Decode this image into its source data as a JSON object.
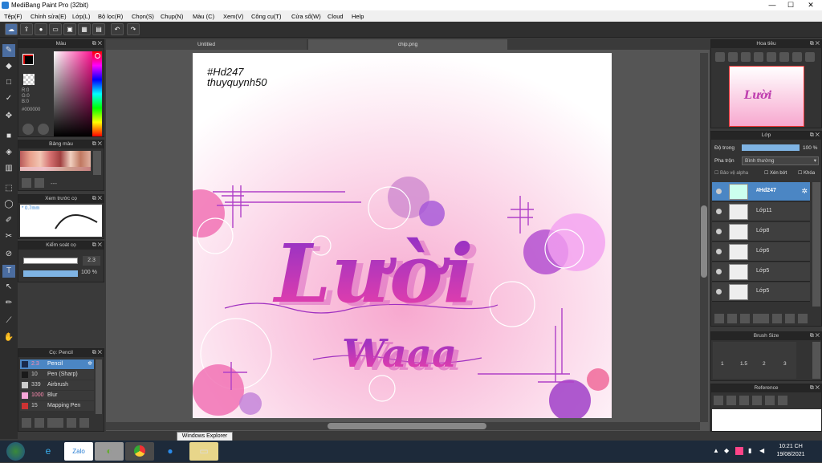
{
  "window": {
    "title": "MediBang Paint Pro (32bit)",
    "min": "—",
    "max": "☐",
    "close": "✕"
  },
  "menu": [
    "Tệp(F)",
    "Chỉnh sửa(E)",
    "Lớp(L)",
    "Bộ lọc(R)",
    "Chọn(S)",
    "Chụp(N)",
    "Màu (C)",
    "Xem(V)",
    "Công cụ(T)",
    "Cửa sổ(W)",
    "Cloud",
    "Help"
  ],
  "color_panel": {
    "title": "Màu",
    "r": "R:0",
    "g": "G:0",
    "b": "B:0",
    "hex": "#000000"
  },
  "palette_panel": {
    "title": "Bảng màu",
    "dash": "---"
  },
  "brush_preview": {
    "title": "Xem trước cọ",
    "size": "* 0.7mm"
  },
  "brush_control": {
    "title": "Kiểm soát cọ",
    "size": "2.3",
    "opacity": "100 %"
  },
  "brushes": {
    "title": "Cọ: Pencil",
    "items": [
      {
        "size": "2.3",
        "name": "Pencil",
        "color": "#1a2a4a"
      },
      {
        "size": "10",
        "name": "Pen (Sharp)",
        "color": "#1a1a1a"
      },
      {
        "size": "339",
        "name": "Airbrush",
        "color": "#cccccc"
      },
      {
        "size": "1000",
        "name": "Blur",
        "color": "#f6a6d8"
      },
      {
        "size": "15",
        "name": "Mapping Pen",
        "color": "#cc3333"
      }
    ]
  },
  "tabs": {
    "untitled": "Untitled",
    "chip": "chip.png"
  },
  "canvas": {
    "line1": "#Hd247",
    "line2": "thuyquynh50",
    "word1": "Lười",
    "word2": "Waaa"
  },
  "navigator": {
    "title": "Hoa tiêu"
  },
  "layer_panel": {
    "title": "Lớp",
    "opacity_label": "Độ trong",
    "opacity_value": "100 %",
    "blend_label": "Pha trộn",
    "blend_value": "Bình thường",
    "protect_alpha": "Bảo vệ alpha",
    "clipping": "Xén bớt",
    "lock": "Khóa",
    "layers": [
      "#Hd247",
      "Lớp11",
      "Lớp8",
      "Lớp6",
      "Lớp5",
      "Lớp5"
    ]
  },
  "brush_size": {
    "title": "Brush Size",
    "labels": [
      "1",
      "1.5",
      "2",
      "3"
    ]
  },
  "reference": {
    "title": "Reference"
  },
  "taskbar": {
    "tooltip": "Windows Explorer",
    "time": "10:21 CH",
    "date": "19/08/2021"
  }
}
